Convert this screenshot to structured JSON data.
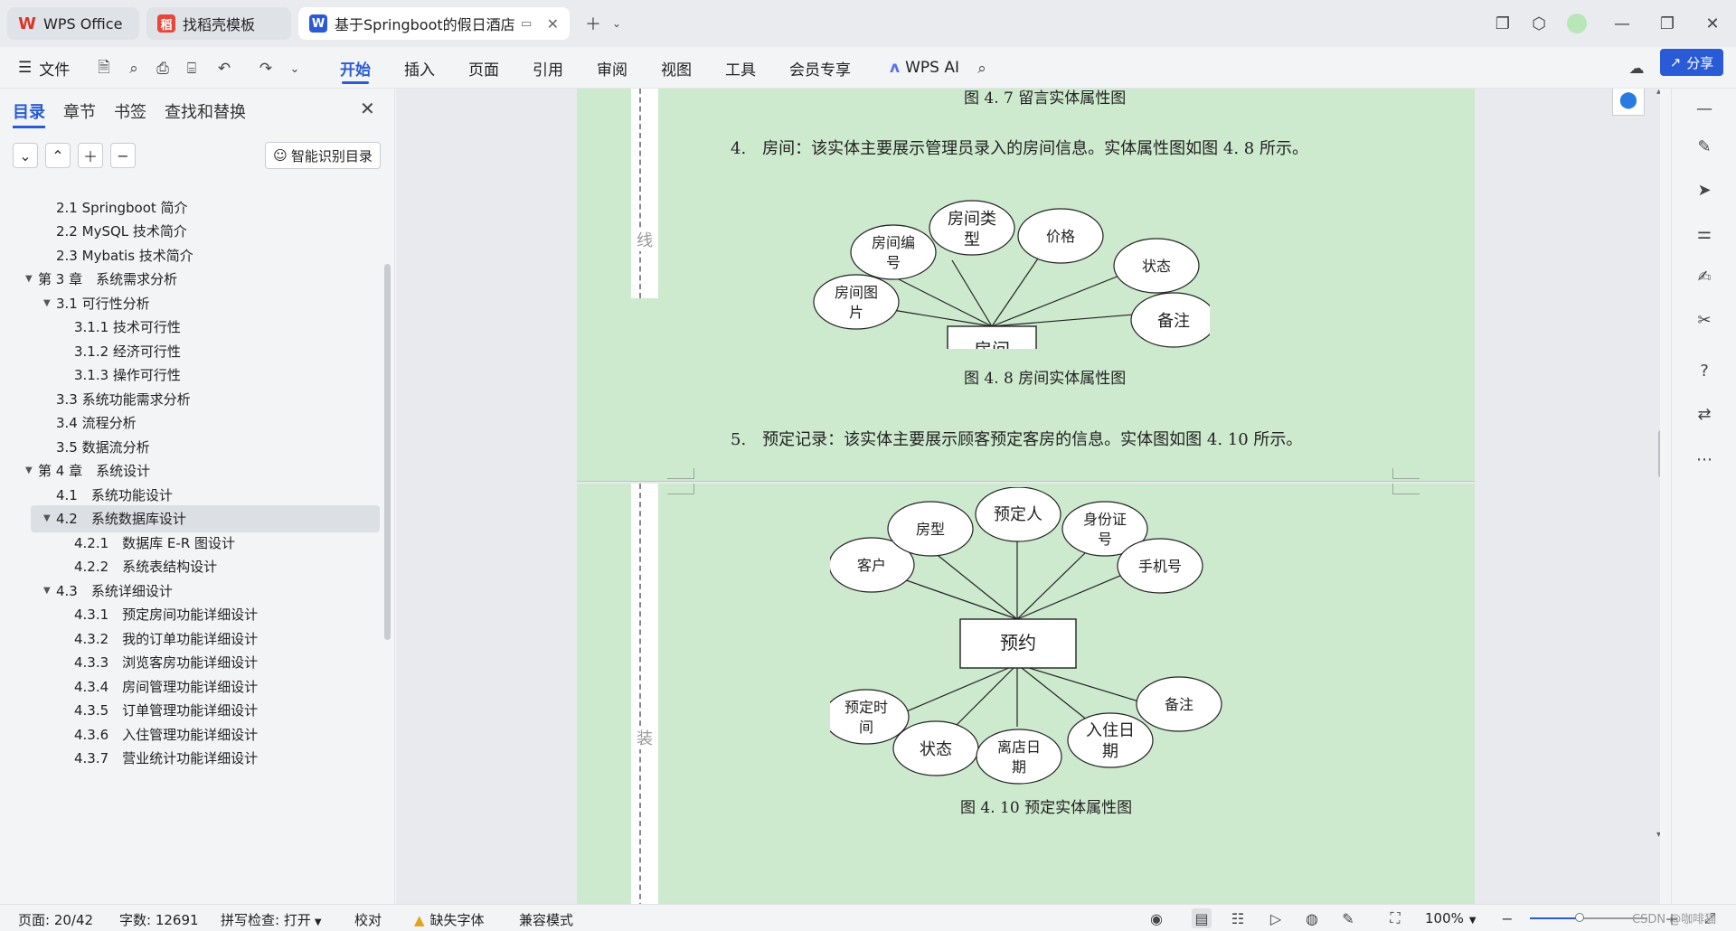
{
  "tabs": [
    {
      "label": "WPS Office",
      "icon": "wps-logo-icon"
    },
    {
      "label": "找稻壳模板",
      "icon": "docer-icon"
    },
    {
      "label": "基于Springboot的假日酒店管",
      "icon": "word-doc-icon"
    }
  ],
  "menubar": {
    "file_label": "文件",
    "items": [
      "开始",
      "插入",
      "页面",
      "引用",
      "审阅",
      "视图",
      "工具",
      "会员专享"
    ],
    "selected": "开始",
    "wps_ai_label": "WPS AI",
    "share_label": "分享"
  },
  "nav": {
    "tabs": [
      "目录",
      "章节",
      "书签",
      "查找和替换"
    ],
    "smart_toc_label": "智能识别目录",
    "toc": [
      {
        "label": "2.1 Springboot 简介",
        "level": 2,
        "arrow": ""
      },
      {
        "label": "2.2 MySQL 技术简介",
        "level": 2,
        "arrow": ""
      },
      {
        "label": "2.3 Mybatis 技术简介",
        "level": 2,
        "arrow": ""
      },
      {
        "label": "第 3 章　系统需求分析",
        "level": 1,
        "arrow": "▼"
      },
      {
        "label": "3.1 可行性分析",
        "level": 2,
        "arrow": "▼"
      },
      {
        "label": "3.1.1 技术可行性",
        "level": 3,
        "arrow": ""
      },
      {
        "label": "3.1.2 经济可行性",
        "level": 3,
        "arrow": ""
      },
      {
        "label": "3.1.3 操作可行性",
        "level": 3,
        "arrow": ""
      },
      {
        "label": "3.3 系统功能需求分析",
        "level": 2,
        "arrow": ""
      },
      {
        "label": "3.4 流程分析",
        "level": 2,
        "arrow": ""
      },
      {
        "label": "3.5 数据流分析",
        "level": 2,
        "arrow": ""
      },
      {
        "label": "第 4 章　系统设计",
        "level": 1,
        "arrow": "▼"
      },
      {
        "label": "4.1　系统功能设计",
        "level": 2,
        "arrow": ""
      },
      {
        "label": "4.2　系统数据库设计",
        "level": 2,
        "arrow": "▼",
        "highlighted": true
      },
      {
        "label": "4.2.1　数据库 E-R 图设计",
        "level": 3,
        "arrow": ""
      },
      {
        "label": "4.2.2　系统表结构设计",
        "level": 3,
        "arrow": ""
      },
      {
        "label": "4.3　系统详细设计",
        "level": 2,
        "arrow": "▼"
      },
      {
        "label": "4.3.1　预定房间功能详细设计",
        "level": 3,
        "arrow": ""
      },
      {
        "label": "4.3.2　我的订单功能详细设计",
        "level": 3,
        "arrow": ""
      },
      {
        "label": "4.3.3　浏览客房功能详细设计",
        "level": 3,
        "arrow": ""
      },
      {
        "label": "4.3.4　房间管理功能详细设计",
        "level": 3,
        "arrow": ""
      },
      {
        "label": "4.3.5　订单管理功能详细设计",
        "level": 3,
        "arrow": ""
      },
      {
        "label": "4.3.6　入住管理功能详细设计",
        "level": 3,
        "arrow": ""
      },
      {
        "label": "4.3.7　营业统计功能详细设计",
        "level": 3,
        "arrow": ""
      }
    ]
  },
  "doc": {
    "binding_char_1": "线",
    "binding_char_2": "装",
    "caption_top": "图 4. 7 留言实体属性图",
    "para_4": "4.　房间：该实体主要展示管理员录入的房间信息。实体属性图如图 4. 8 所示。",
    "caption_room": "图 4. 8 房间实体属性图",
    "para_5": "5.　预定记录：该实体主要展示顾客预定客房的信息。实体图如图 4. 10 所示。",
    "caption_reserve": "图 4. 10 预定实体属性图",
    "room_er": {
      "entity": "房间",
      "attributes": [
        "房间图片",
        "房间编号",
        "房间类型",
        "价格",
        "状态",
        "备注"
      ]
    },
    "reserve_er": {
      "entity": "预约",
      "attributes": [
        "客户",
        "房型",
        "预定人",
        "身份证号",
        "手机号",
        "预定时间",
        "状态",
        "离店日期",
        "入住日期",
        "备注"
      ]
    }
  },
  "status": {
    "page": "页面: 20/42",
    "words": "字数: 12691",
    "spell": "拼写检查: 打开",
    "proof": "校对",
    "missing_font": "缺失字体",
    "compat": "兼容模式",
    "zoom": "100%",
    "zoom_fraction": 0.42
  },
  "watermark": "CSDN @咖啡猫"
}
